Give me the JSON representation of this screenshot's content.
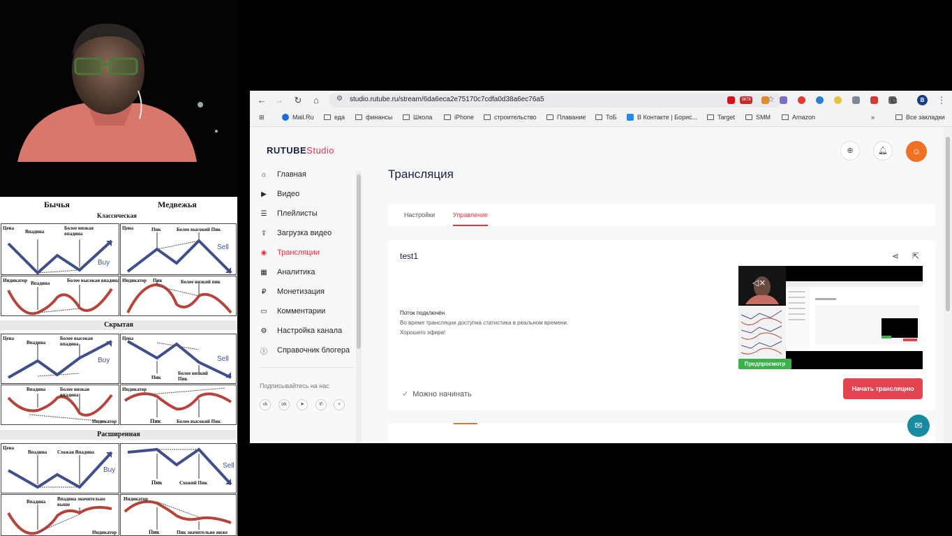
{
  "browser": {
    "url": "studio.rutube.ru/stream/6da6eca2e75170c7cdfa0d38a6ec76a5",
    "profile_initial": "B",
    "ext_badge": "3678"
  },
  "bookmarks": [
    {
      "label": "Mail.Ru"
    },
    {
      "label": "еда"
    },
    {
      "label": "финансы"
    },
    {
      "label": "Школа"
    },
    {
      "label": "iPhone"
    },
    {
      "label": "строительство"
    },
    {
      "label": "Плавание"
    },
    {
      "label": "ТоБ"
    },
    {
      "label": "В Контакте | Борис..."
    },
    {
      "label": "Target"
    },
    {
      "label": "SMM"
    },
    {
      "label": "Amazon"
    }
  ],
  "bookmarks_all": "Все закладки",
  "studio": {
    "logo_brand": "RUTUBE",
    "logo_suffix": "Studio",
    "sidebar": [
      {
        "label": "Главная",
        "icon": "home-icon"
      },
      {
        "label": "Видео",
        "icon": "video-icon"
      },
      {
        "label": "Плейлисты",
        "icon": "playlist-icon"
      },
      {
        "label": "Загрузка видео",
        "icon": "upload-icon"
      },
      {
        "label": "Трансляции",
        "icon": "broadcast-icon",
        "active": true
      },
      {
        "label": "Аналитика",
        "icon": "analytics-icon"
      },
      {
        "label": "Монетизация",
        "icon": "ruble-icon"
      },
      {
        "label": "Комментарии",
        "icon": "comment-icon"
      },
      {
        "label": "Настройка канала",
        "icon": "gear-icon"
      },
      {
        "label": "Справочник блогера",
        "icon": "info-icon"
      }
    ],
    "subscribe_label": "Подписывайтесь на нас",
    "socials": [
      "vk-icon",
      "ok-icon",
      "telegram-icon",
      "viber-icon",
      "plus-icon"
    ],
    "title": "Трансляция",
    "tabs": [
      {
        "label": "Настройки"
      },
      {
        "label": "Управление",
        "active": true
      }
    ],
    "stream": {
      "name": "test1",
      "status_title": "Поток подключён",
      "status_line1": "Во время трансляции доступна статистика в реальном времени.",
      "status_line2": "Хорошего эфира!",
      "preview_badge": "Предпросмотр",
      "ready_text": "Можно начинать",
      "start_button": "Начать трансляцию"
    }
  },
  "infographic": {
    "col_bull": "Бычья",
    "col_bear": "Медвежья",
    "sections": [
      {
        "title": "Классическая",
        "bull_price": [
          "Цена",
          "Впадина",
          "Более низкая впадина",
          "Buy"
        ],
        "bear_price": [
          "Цена",
          "Пик",
          "Более высокий Пик",
          "Sell"
        ],
        "bull_ind": [
          "Индикатор",
          "Впадина",
          "Более высокая впадина"
        ],
        "bear_ind": [
          "Индикатор",
          "Пик",
          "Более низкий пик"
        ]
      },
      {
        "title": "Скрытая",
        "bull_price": [
          "Цена",
          "Впадина",
          "Более высокая впадина",
          "Buy"
        ],
        "bear_price": [
          "Цена",
          "Пик",
          "Более низкий Пик",
          "Sell"
        ],
        "bull_ind": [
          "Впадина",
          "Более низкая впадина",
          "Индикатор"
        ],
        "bear_ind": [
          "Индикатор",
          "Пик",
          "Более высокий Пик"
        ]
      },
      {
        "title": "Расширенная",
        "bull_price": [
          "Цена",
          "Впадина",
          "Схожая Впадина",
          "Buy"
        ],
        "bear_price": [
          "Пик",
          "Схожий Пик",
          "Sell"
        ],
        "bull_ind": [
          "Впадина",
          "Впадина значительно выше",
          "Индикатор"
        ],
        "bear_ind": [
          "Индикатор",
          "Пик",
          "Пик значительно ниже"
        ]
      }
    ]
  },
  "colors": {
    "accent": "#e2313f",
    "start_button": "#e2454f",
    "preview_badge": "#3cb04a",
    "avatar": "#f07024",
    "price_line": "#3f4f8a",
    "indicator_line": "#b5453a"
  }
}
